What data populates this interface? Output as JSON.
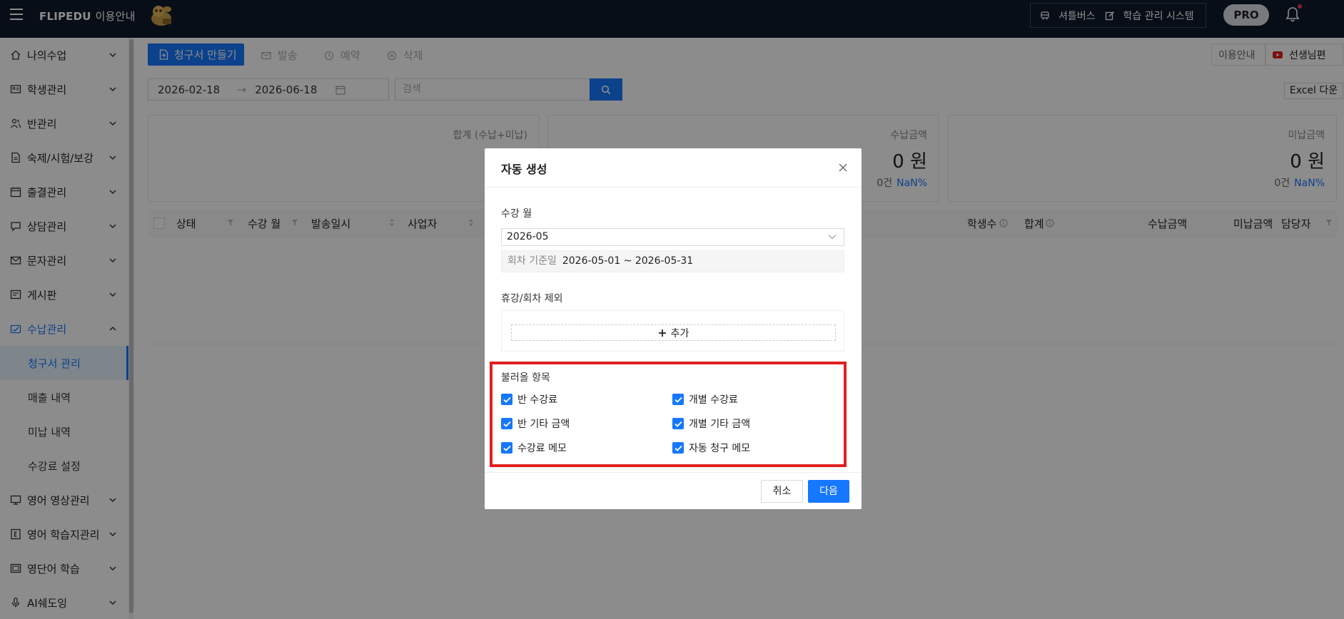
{
  "topbar": {
    "brand": "FLIPEDU",
    "guide": "이용안내",
    "links": [
      {
        "label": "셔틀버스",
        "icon": "bus-icon"
      },
      {
        "label": "학습 관리 시스템",
        "icon": "edit-icon"
      }
    ],
    "pro": "PRO"
  },
  "sidebar": {
    "items": [
      {
        "label": "나의수업"
      },
      {
        "label": "학생관리"
      },
      {
        "label": "반관리"
      },
      {
        "label": "숙제/시험/보강"
      },
      {
        "label": "출결관리"
      },
      {
        "label": "상담관리"
      },
      {
        "label": "문자관리"
      },
      {
        "label": "게시판"
      },
      {
        "label": "수납관리"
      },
      {
        "label": "영어 영상관리"
      },
      {
        "label": "영어 학습지관리"
      },
      {
        "label": "영단어 학습"
      },
      {
        "label": "AI쉐도잉"
      }
    ],
    "subitems": [
      {
        "label": "청구서 관리"
      },
      {
        "label": "매출 내역"
      },
      {
        "label": "미납 내역"
      },
      {
        "label": "수강료 설정"
      }
    ]
  },
  "toolbar": {
    "create": "청구서 만들기",
    "send": "발송",
    "reserve": "예약",
    "delete": "삭제",
    "guide": "이용안내",
    "teacher": "선생님편"
  },
  "filter": {
    "date_from": "2026-02-18",
    "date_to": "2026-06-18",
    "search_placeholder": "검색",
    "excel": "Excel 다운"
  },
  "stats": [
    {
      "title": "합계 (수납+미납)",
      "amount": "",
      "count": "",
      "pct": ""
    },
    {
      "title": "수납금액",
      "amount": "0 원",
      "count": "0건",
      "pct": "NaN%"
    },
    {
      "title": "미납금액",
      "amount": "0 원",
      "count": "0건",
      "pct": "NaN%"
    }
  ],
  "table": {
    "headers": [
      "상태",
      "수강 월",
      "발송일시",
      "사업자",
      "학생수",
      "합계",
      "수납금액",
      "미납금액",
      "담당자"
    ]
  },
  "modal": {
    "title": "자동 생성",
    "month_label": "수강 월",
    "month_value": "2026-05",
    "period_key": "회차 기준일",
    "period_value": "2026-05-01 ~ 2026-05-31",
    "exclude_label": "휴강/회차 제외",
    "add": "추가",
    "import_label": "불러올 항목",
    "checkboxes": [
      {
        "label": "반 수강료",
        "checked": true
      },
      {
        "label": "개별 수강료",
        "checked": true
      },
      {
        "label": "반 기타 금액",
        "checked": true
      },
      {
        "label": "개별 기타 금액",
        "checked": true
      },
      {
        "label": "수강료 메모",
        "checked": true
      },
      {
        "label": "자동 청구 메모",
        "checked": true
      }
    ],
    "cancel": "취소",
    "next": "다음"
  },
  "colors": {
    "accent": "#1677ff",
    "topbar": "#0f1a2a",
    "highlight": "#e02020"
  }
}
